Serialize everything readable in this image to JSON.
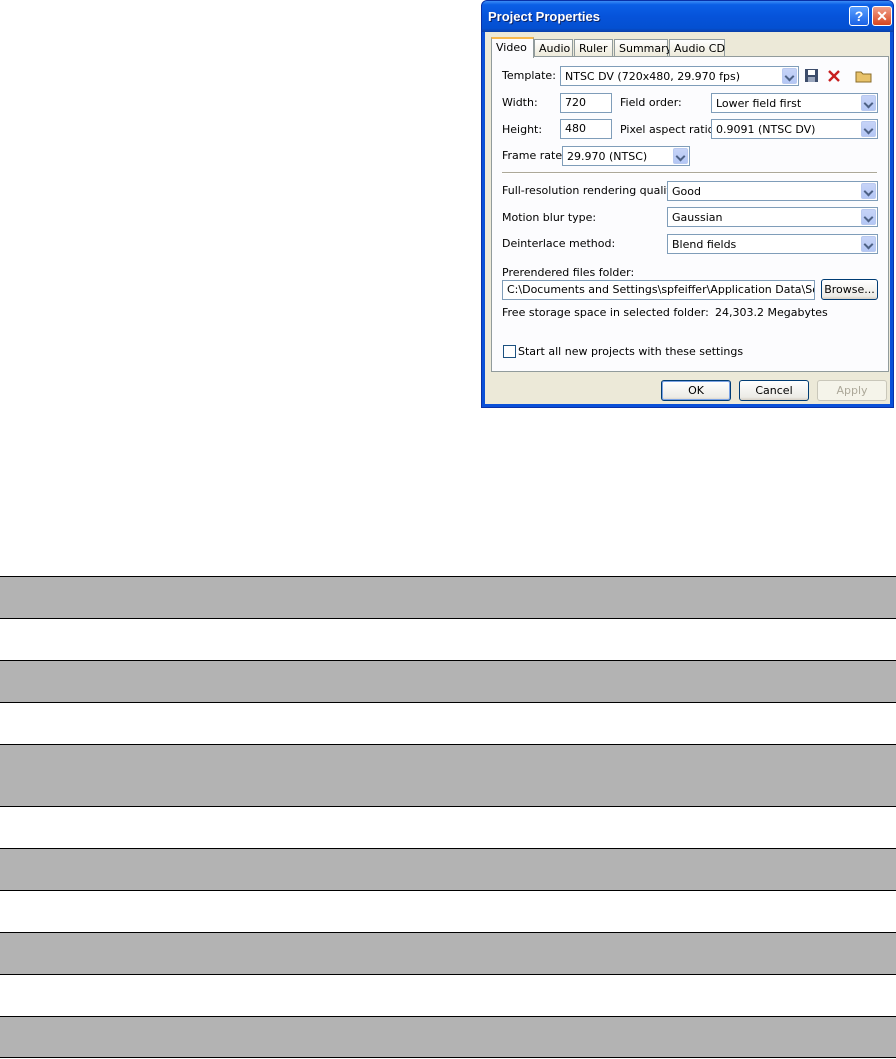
{
  "dialog": {
    "title": "Project Properties",
    "help_button": "?",
    "close_button": "✕",
    "tabs": [
      {
        "label": "Video",
        "active": true
      },
      {
        "label": "Audio"
      },
      {
        "label": "Ruler"
      },
      {
        "label": "Summary"
      },
      {
        "label": "Audio CD"
      }
    ],
    "template": {
      "label": "Template:",
      "value": "NTSC DV (720x480, 29.970 fps)"
    },
    "width": {
      "label": "Width:",
      "value": "720"
    },
    "height": {
      "label": "Height:",
      "value": "480"
    },
    "field_order": {
      "label": "Field order:",
      "value": "Lower field first"
    },
    "pixel_aspect": {
      "label": "Pixel aspect ratio:",
      "value": "0.9091 (NTSC DV)"
    },
    "frame_rate": {
      "label": "Frame rate:",
      "value": "29.970 (NTSC)"
    },
    "render_quality": {
      "label": "Full-resolution rendering quality:",
      "value": "Good"
    },
    "motion_blur": {
      "label": "Motion blur type:",
      "value": "Gaussian"
    },
    "deinterlace": {
      "label": "Deinterlace method:",
      "value": "Blend fields"
    },
    "prerendered_folder": {
      "label": "Prerendered files folder:",
      "value": "C:\\Documents and Settings\\spfeiffer\\Application Data\\Sony\\Vegas",
      "browse_label": "Browse..."
    },
    "free_storage": {
      "label": "Free storage space in selected folder:",
      "value": "24,303.2 Megabytes"
    },
    "start_all_checkbox": {
      "label": "Start all new projects with these settings",
      "checked": false
    },
    "ok_label": "OK",
    "cancel_label": "Cancel",
    "apply_label": "Apply"
  },
  "colors": {
    "title_bar": "#0653da",
    "dialog_face": "#ece9d8",
    "row_shade": "#b3b3b3"
  }
}
